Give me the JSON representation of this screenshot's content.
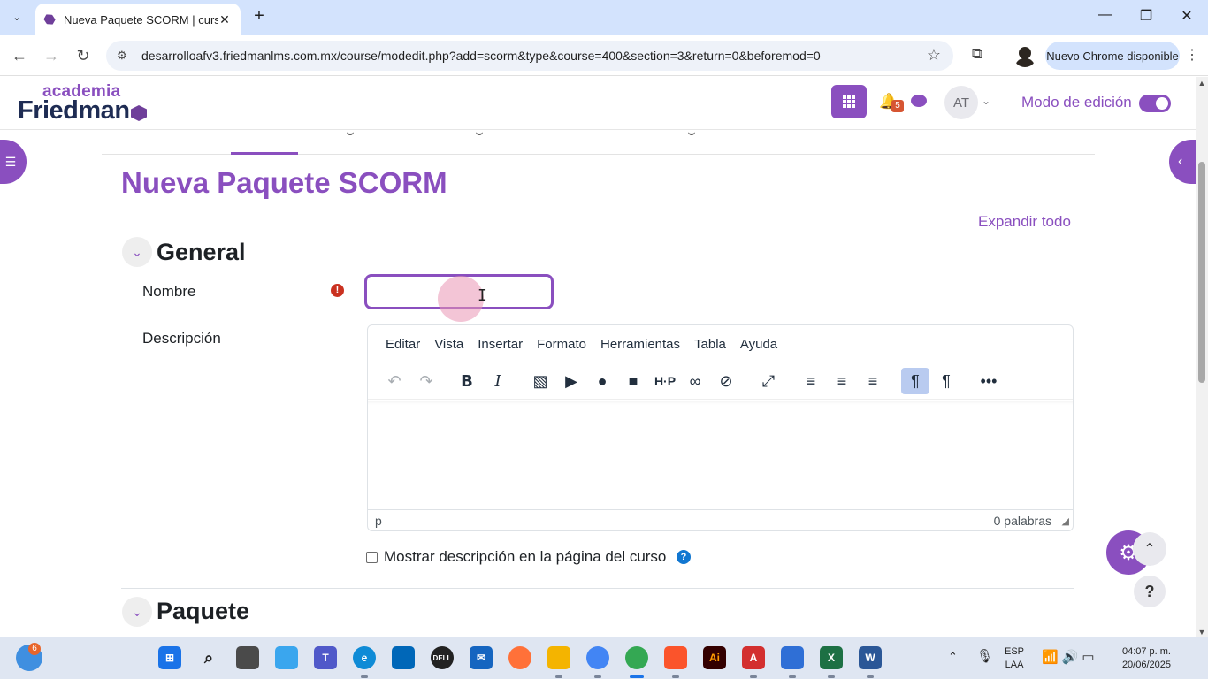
{
  "browser": {
    "tab_title": "Nueva Paquete SCORM | curso:",
    "tab_close": "✕",
    "new_tab": "+",
    "url": "desarrolloafv3.friedmanlms.com.mx/course/modedit.php?add=scorm&type&course=400&section=3&return=0&beforemod=0",
    "update_label": "Nuevo Chrome disponible",
    "window_controls": {
      "minimize": "—",
      "maximize": "❐",
      "close": "✕"
    }
  },
  "header": {
    "logo_top": "academia",
    "logo_main": "Friedman",
    "notification_count": "5",
    "avatar_initials": "AT",
    "edit_mode_label": "Modo de edición",
    "edit_mode_on": true
  },
  "page": {
    "title": "Nueva Paquete SCORM",
    "expand_all": "Expandir todo"
  },
  "sections": {
    "general": "General",
    "package": "Paquete"
  },
  "form": {
    "name_label": "Nombre",
    "name_value": "",
    "required_icon": "!",
    "description_label": "Descripción",
    "show_description_label": "Mostrar descripción en la página del curso",
    "show_description_checked": false,
    "help_icon": "?"
  },
  "editor": {
    "menus": [
      "Editar",
      "Vista",
      "Insertar",
      "Formato",
      "Herramientas",
      "Tabla",
      "Ayuda"
    ],
    "status_path": "p",
    "word_count": "0 palabras"
  },
  "icons": {
    "undo": "undo-icon",
    "redo": "redo-icon",
    "bold": "bold-icon",
    "italic": "italic-icon",
    "image": "image-icon",
    "media": "media-icon",
    "audio": "microphone-icon",
    "video": "video-camera-icon",
    "h5p": "h5p-icon",
    "link": "link-icon",
    "unlink": "unlink-icon",
    "fullscreen": "fullscreen-icon",
    "align_left": "align-left-icon",
    "align_center": "align-center-icon",
    "align_right": "align-right-icon",
    "ltr": "ltr-icon",
    "rtl": "rtl-icon",
    "more": "more-icon"
  },
  "taskbar": {
    "weather_badge": "6",
    "language_line1": "ESP",
    "language_line2": "LAA",
    "time": "04:07 p. m.",
    "date": "20/06/2025"
  },
  "colors": {
    "brand_purple": "#8a4fbf",
    "navy": "#1e2c53",
    "required_red": "#ca3120",
    "help_blue": "#1177d1"
  }
}
